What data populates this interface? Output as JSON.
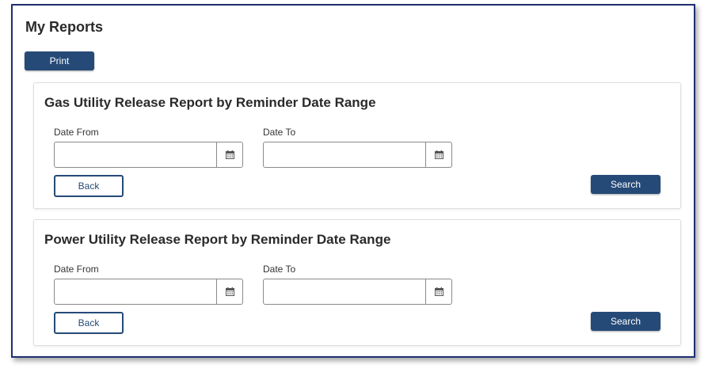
{
  "page": {
    "title": "My Reports",
    "print_label": "Print"
  },
  "reports": [
    {
      "title": "Gas Utility Release Report by Reminder Date Range",
      "date_from_label": "Date From",
      "date_from_value": "",
      "date_to_label": "Date To",
      "date_to_value": "",
      "back_label": "Back",
      "search_label": "Search"
    },
    {
      "title": "Power Utility Release Report by Reminder Date Range",
      "date_from_label": "Date From",
      "date_from_value": "",
      "date_to_label": "Date To",
      "date_to_value": "",
      "back_label": "Back",
      "search_label": "Search"
    }
  ],
  "icons": {
    "calendar": "calendar-icon"
  },
  "colors": {
    "primary": "#254a77",
    "frame_border": "#1f2f72"
  }
}
